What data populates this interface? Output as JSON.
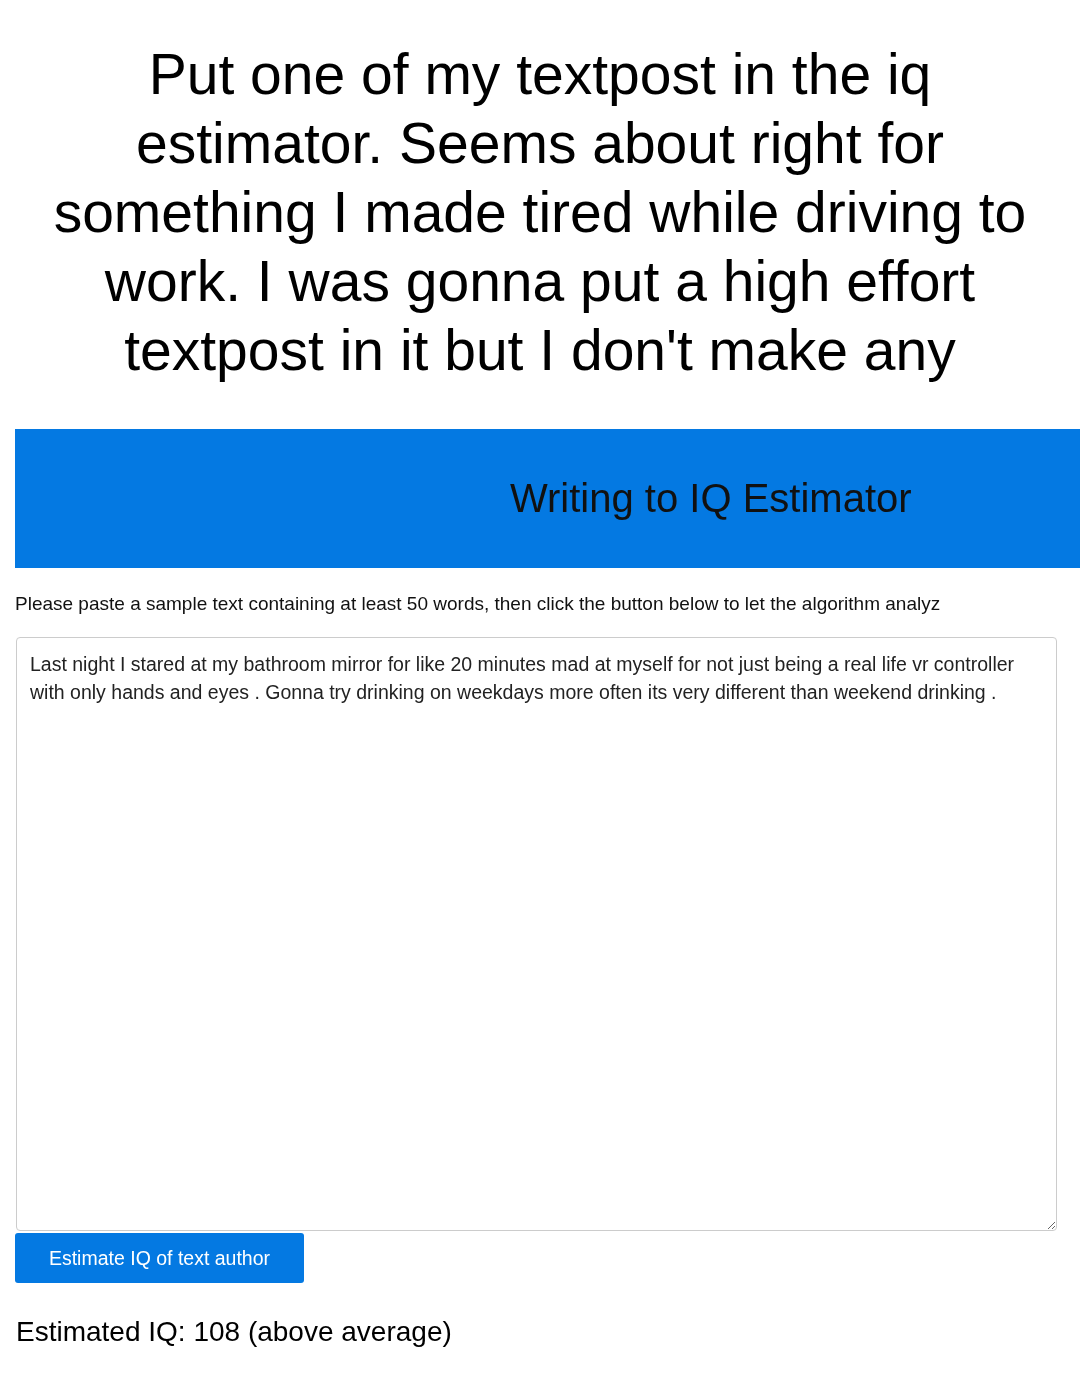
{
  "caption": "Put one of my textpost in the iq estimator. Seems about right for something I made tired while driving to work. I was gonna put a high effort textpost in it but I don't make any",
  "page": {
    "title": "Writing to IQ Estimator",
    "instructions": "Please paste a sample text containing at least 50 words, then click the button below to let the algorithm analyz",
    "sample_text": "Last night I stared at my bathroom mirror for like 20 minutes mad at myself for not just being a real life vr controller with only hands and eyes . Gonna try drinking on weekdays more often its very different than weekend drinking .",
    "button": "Estimate IQ of text author",
    "result": "Estimated IQ: 108 (above average)"
  }
}
